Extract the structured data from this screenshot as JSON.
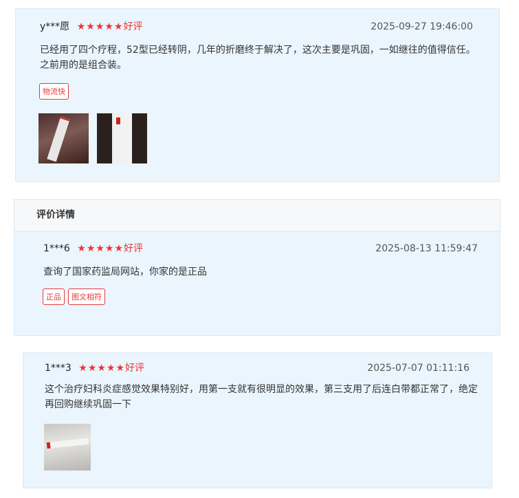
{
  "reviews": [
    {
      "user": "y***愿",
      "stars": "★★★★★",
      "rating": "好评",
      "date": "2025-09-27 19:46:00",
      "text": "已经用了四个疗程，52型已经转阴，几年的折磨终于解决了，这次主要是巩固，一如继往的值得信任。之前用的是组合装。",
      "tags": [
        "物流快"
      ]
    },
    {
      "user": "1***6",
      "stars": "★★★★★",
      "rating": "好评",
      "date": "2025-08-13 11:59:47",
      "text": "查询了国家药监局网站，你家的是正品",
      "tags": [
        "正品",
        "图文相符"
      ]
    },
    {
      "user": "1***3",
      "stars": "★★★★★",
      "rating": "好评",
      "date": "2025-07-07 01:11:16",
      "text": "这个治疗妇科炎症感觉效果特别好，用第一支就有很明显的效果，第三支用了后连白带都正常了，绝定再回购继续巩固一下",
      "tags": []
    }
  ],
  "detail_header": "评价详情",
  "colors": {
    "accent": "#ee3333",
    "card_bg": "#eaf5fe"
  }
}
